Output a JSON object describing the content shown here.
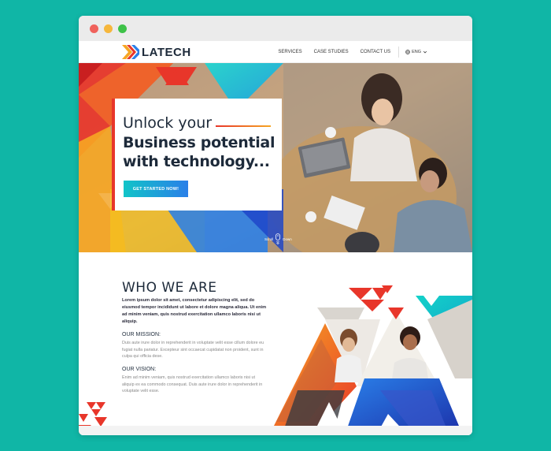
{
  "browser": {
    "controls": [
      "close",
      "minimize",
      "maximize"
    ]
  },
  "brand": {
    "name": "LATECH",
    "colors": {
      "red": "#e8362a",
      "orange": "#f6a623",
      "blue": "#2a7fe8",
      "teal": "#12c4c8",
      "navy": "#1d2a3a"
    }
  },
  "nav": {
    "links": [
      "SERVICES",
      "CASE STUDIES",
      "CONTACT US"
    ],
    "language": "ENG"
  },
  "hero": {
    "line1": "Unlock your",
    "line2": "Business potential",
    "line3": "with technology...",
    "cta": "GET STARTED NOW!",
    "scroll_left": "Scroll",
    "scroll_right": "Down"
  },
  "about": {
    "title": "WHO WE ARE",
    "lead": "Lorem ipsum dolor sit amet, consectetur adipiscing elit, sed do eiusmod tempor incididunt ut labore et dolore magna aliqua. Ut enim ad minim veniam, quis nostrud exercitation ullamco laboris nisi ut aliquip.",
    "mission_title": "OUR MISSION:",
    "mission_text": "Duis aute irure dolor in reprehenderit in voluptate velit esse cillum dolore eu fugiat nulla pariatur. Excepteur sint occaecat cupidatat non proident, sunt in culpa qui officia dese.",
    "vision_title": "OUR VISION:",
    "vision_text": "Enim ad minim veniam, quis nostrud exercitation ullamco laboris nisi ut aliquip ex ea commodo consequat. Duis aute irure dolor in reprehenderit in voluptate velit esse."
  }
}
